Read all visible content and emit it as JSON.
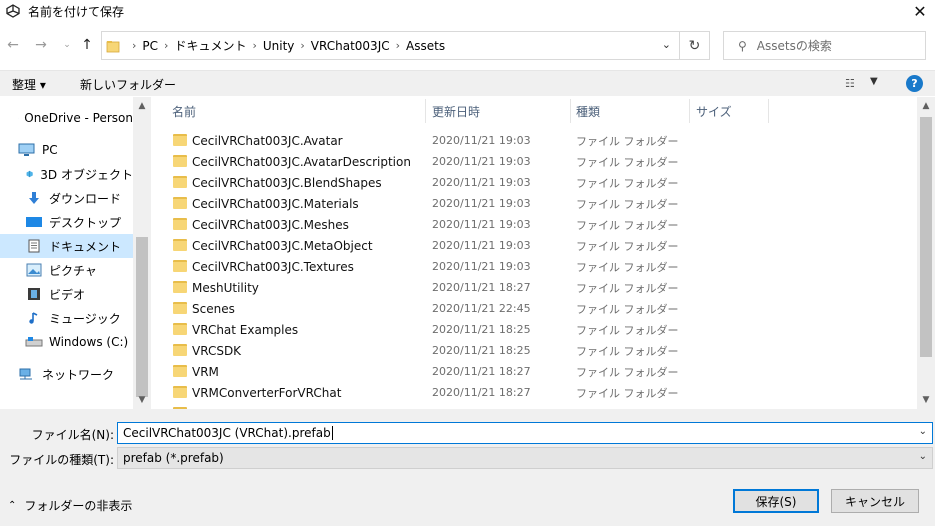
{
  "window": {
    "title": "名前を付けて保存",
    "close_glyph": "✕"
  },
  "address": {
    "crumbs": [
      "PC",
      "ドキュメント",
      "Unity",
      "VRChat003JC",
      "Assets"
    ],
    "separator": "›",
    "search_placeholder": "Assetsの検索"
  },
  "toolbar": {
    "organize": "整理 ▾",
    "new_folder": "新しいフォルダー"
  },
  "sidebar": {
    "items": [
      {
        "label": "OneDrive - Person",
        "icon": "cloud-icon"
      },
      {
        "label": "PC",
        "icon": "computer-icon"
      },
      {
        "label": "3D オブジェクト",
        "icon": "3d-objects-icon"
      },
      {
        "label": "ダウンロード",
        "icon": "download-icon"
      },
      {
        "label": "デスクトップ",
        "icon": "desktop-icon"
      },
      {
        "label": "ドキュメント",
        "icon": "documents-icon",
        "selected": true
      },
      {
        "label": "ピクチャ",
        "icon": "pictures-icon"
      },
      {
        "label": "ビデオ",
        "icon": "video-icon"
      },
      {
        "label": "ミュージック",
        "icon": "music-icon"
      },
      {
        "label": "Windows (C:)",
        "icon": "drive-icon"
      },
      {
        "label": "ネットワーク",
        "icon": "network-icon"
      }
    ]
  },
  "columns": {
    "name": "名前",
    "date": "更新日時",
    "type": "種類",
    "size": "サイズ"
  },
  "files": [
    {
      "name": "CecilVRChat003JC.Avatar",
      "date": "2020/11/21 19:03",
      "type": "ファイル フォルダー"
    },
    {
      "name": "CecilVRChat003JC.AvatarDescription",
      "date": "2020/11/21 19:03",
      "type": "ファイル フォルダー"
    },
    {
      "name": "CecilVRChat003JC.BlendShapes",
      "date": "2020/11/21 19:03",
      "type": "ファイル フォルダー"
    },
    {
      "name": "CecilVRChat003JC.Materials",
      "date": "2020/11/21 19:03",
      "type": "ファイル フォルダー"
    },
    {
      "name": "CecilVRChat003JC.Meshes",
      "date": "2020/11/21 19:03",
      "type": "ファイル フォルダー"
    },
    {
      "name": "CecilVRChat003JC.MetaObject",
      "date": "2020/11/21 19:03",
      "type": "ファイル フォルダー"
    },
    {
      "name": "CecilVRChat003JC.Textures",
      "date": "2020/11/21 19:03",
      "type": "ファイル フォルダー"
    },
    {
      "name": "MeshUtility",
      "date": "2020/11/21 18:27",
      "type": "ファイル フォルダー"
    },
    {
      "name": "Scenes",
      "date": "2020/11/21 22:45",
      "type": "ファイル フォルダー"
    },
    {
      "name": "VRChat Examples",
      "date": "2020/11/21 18:25",
      "type": "ファイル フォルダー"
    },
    {
      "name": "VRCSDK",
      "date": "2020/11/21 18:25",
      "type": "ファイル フォルダー"
    },
    {
      "name": "VRM",
      "date": "2020/11/21 18:27",
      "type": "ファイル フォルダー"
    },
    {
      "name": "VRMConverterForVRChat",
      "date": "2020/11/21 18:27",
      "type": "ファイル フォルダー"
    }
  ],
  "form": {
    "filename_label": "ファイル名(N):",
    "filename_value": "CecilVRChat003JC (VRChat).prefab",
    "filetype_label": "ファイルの種類(T):",
    "filetype_value": "prefab (*.prefab)"
  },
  "footer": {
    "hide_folders": "フォルダーの非表示",
    "save": "保存(S)",
    "cancel": "キャンセル"
  },
  "colors": {
    "accent": "#0078d7",
    "selection": "#cce8ff",
    "folder": "#f7d676"
  }
}
